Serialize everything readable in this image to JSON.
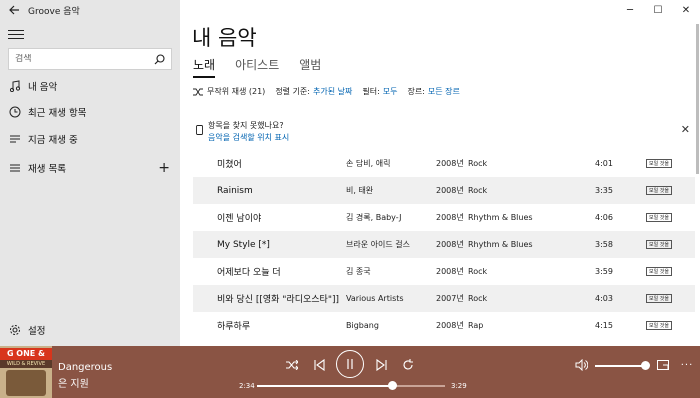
{
  "app": {
    "title": "Groove 음악"
  },
  "window_controls": {
    "minimize": "─",
    "maximize": "☐",
    "close": "✕"
  },
  "sidebar": {
    "search_placeholder": "검색",
    "items": [
      {
        "label": "내 음악",
        "icon": "music-note-icon"
      },
      {
        "label": "최근 재생 항목",
        "icon": "clock-icon"
      },
      {
        "label": "지금 재생 중",
        "icon": "now-playing-icon"
      },
      {
        "label": "재생 목록",
        "icon": "playlist-icon"
      }
    ],
    "add_symbol": "+",
    "settings_label": "설정"
  },
  "main": {
    "title": "내 음악",
    "tabs": [
      {
        "label": "노래",
        "active": true
      },
      {
        "label": "아티스트",
        "active": false
      },
      {
        "label": "앨범",
        "active": false
      }
    ],
    "filters": {
      "shuffle_label": "무작위 재생 (21)",
      "sort_label": "정렬 기준:",
      "sort_value": "추가된 날짜",
      "filter_label": "필터:",
      "filter_value": "모두",
      "genre_label": "장르:",
      "genre_value": "모든 장르"
    },
    "notice": {
      "line1": "항목을 찾지 못했나요?",
      "line2": "음악을 검색할 위치 표시",
      "close": "✕"
    },
    "songs": [
      {
        "title": "미쳤어",
        "artist": "손 담비, 애릭",
        "year": "2008년",
        "genre": "Rock",
        "duration": "4:01",
        "badge": "모일 것을"
      },
      {
        "title": "Rainism",
        "artist": "비, 태완",
        "year": "2008년",
        "genre": "Rock",
        "duration": "3:35",
        "badge": "모일 것을"
      },
      {
        "title": "이젠 남이야",
        "artist": "김 경록, Baby-J",
        "year": "2008년",
        "genre": "Rhythm & Blues",
        "duration": "4:06",
        "badge": "모일 것을"
      },
      {
        "title": "My Style [*]",
        "artist": "브라운 아이드 걸스",
        "year": "2008년",
        "genre": "Rhythm & Blues",
        "duration": "3:58",
        "badge": "모일 것을"
      },
      {
        "title": "어제보다 오늘 더",
        "artist": "김 종국",
        "year": "2008년",
        "genre": "Rock",
        "duration": "3:59",
        "badge": "모일 것을"
      },
      {
        "title": "비와 당신 [[영화 \"라디오스타\"]]",
        "artist": "Various Artists",
        "year": "2007년",
        "genre": "Rock",
        "duration": "4:03",
        "badge": "모일 것을"
      },
      {
        "title": "하루하루",
        "artist": "Bigbang",
        "year": "2008년",
        "genre": "Rap",
        "duration": "4:15",
        "badge": "모일 것을"
      }
    ]
  },
  "player": {
    "album_art_text": "G ONE & CODE",
    "album_art_subtext": "WILD & REVIVE",
    "song": "Dangerous",
    "artist": "은 지원",
    "current_time": "2:34",
    "total_time": "3:29",
    "progress": 0.72,
    "volume": 1.0,
    "accent_color": "#8a5444"
  }
}
